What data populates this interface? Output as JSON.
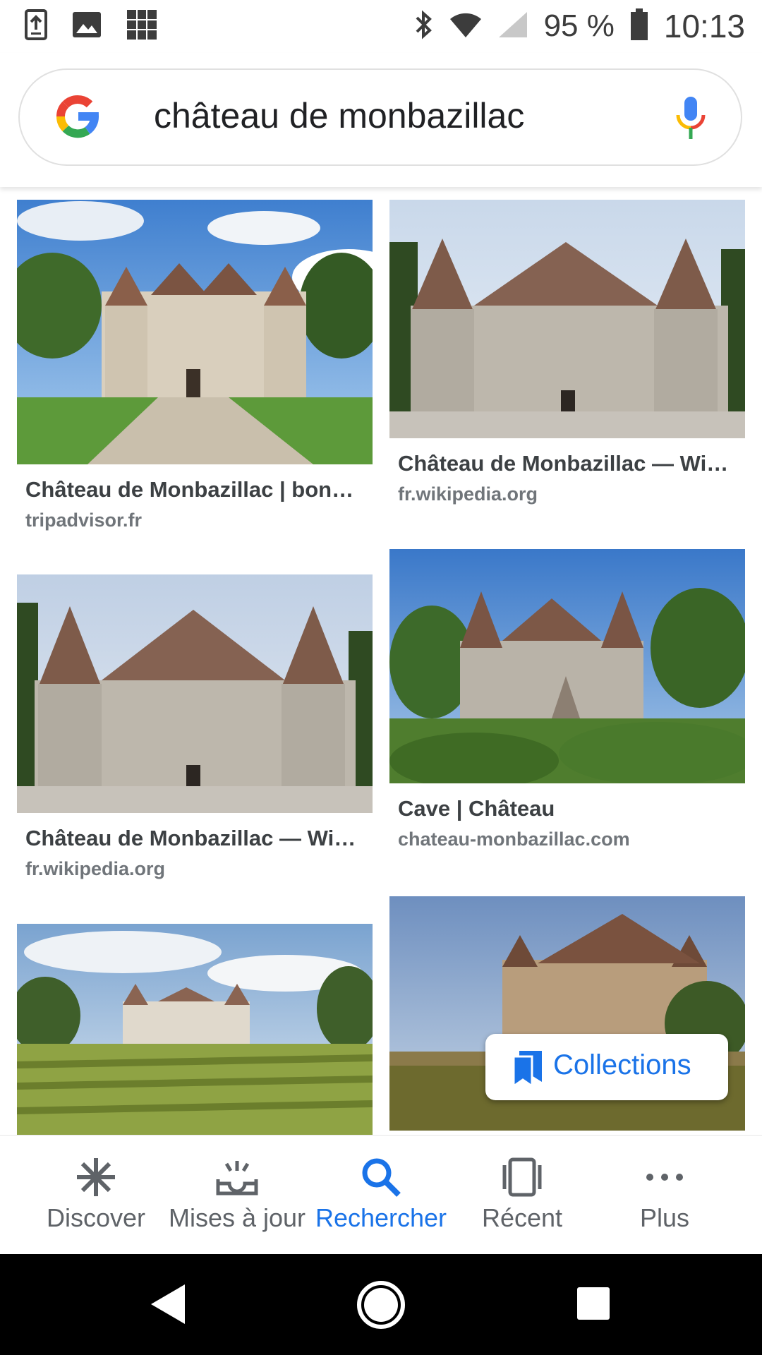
{
  "status_bar": {
    "battery": "95 %",
    "time": "10:13"
  },
  "search": {
    "query": "château de monbazillac"
  },
  "results": [
    {
      "title": "Château de Monbazillac | bon…",
      "source": "tripadvisor.fr"
    },
    {
      "title": "Château de Monbazillac — Wi…",
      "source": "fr.wikipedia.org"
    },
    {
      "title": "Château de Monbazillac — Wi…",
      "source": "fr.wikipedia.org"
    },
    {
      "title": "Cave | Château",
      "source": "chateau-monbazillac.com"
    },
    {
      "title": "",
      "source": ""
    },
    {
      "title": "",
      "source": ""
    }
  ],
  "collections": {
    "label": "Collections",
    "icon": "bookmarks-icon"
  },
  "nav": [
    {
      "label": "Discover",
      "icon": "asterisk-icon"
    },
    {
      "label": "Mises à jour",
      "icon": "inbox-updates-icon"
    },
    {
      "label": "Rechercher",
      "icon": "search-icon"
    },
    {
      "label": "Récent",
      "icon": "recent-cards-icon"
    },
    {
      "label": "Plus",
      "icon": "more-dots-icon"
    }
  ],
  "colors": {
    "accent": "#1a73e8",
    "nav_inactive": "#5f6368",
    "system_bar": "#000000"
  }
}
